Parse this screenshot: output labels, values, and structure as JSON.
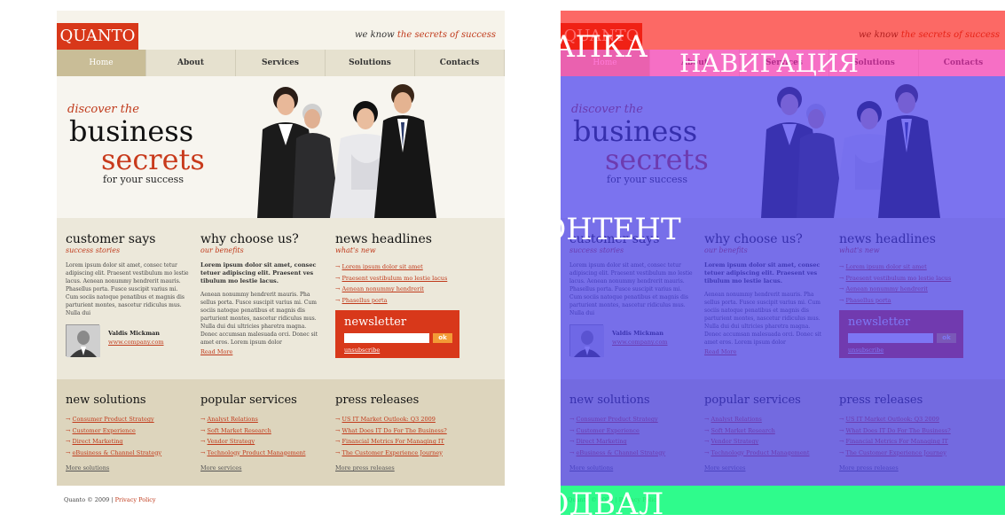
{
  "site": {
    "logo": "QUANTO",
    "tagline_pre": "we know",
    "tagline_em": "the secrets of success",
    "nav": [
      "Home",
      "About",
      "Services",
      "Solutions",
      "Contacts"
    ],
    "hero": {
      "discover": "discover the",
      "business": "business",
      "secrets": "secrets",
      "for": "for your success"
    },
    "col1": {
      "title": "customer says",
      "sub": "success stories",
      "text": "Lorem ipsum dolor sit amet, consec tetur adipiscing elit. Praesent vestibulum mo lestie lacus. Aenean nonummy hendrerit mauris. Phasellus porta. Fusce suscipit varius mi. Cum sociis natoque penatibus et magnis dis parturient montes, nascetur ridiculus mus. Nulla dui",
      "name": "Valdis Mickman",
      "link": "www.company.com"
    },
    "col2": {
      "title": "why choose us?",
      "sub": "our benefits",
      "bold": "Lorem ipsum dolor sit amet, consec tetuer adipiscing elit. Praesent ves tibulum mo lestie lacus.",
      "text": "Aenean nonummy hendrerit mauris. Pha sellus porta. Fusce suscipit varius mi. Cum sociis natoque penatibus et magnis dis parturient montes, nascetur ridiculus mus. Nulla dui dui ultricies pharetra magna. Donec accumsan malesuada orci. Donec sit amet eros. Lorem ipsum dolor",
      "more": "Read More"
    },
    "col3": {
      "title": "news headlines",
      "sub": "what's new",
      "items": [
        "Lorem ipsum dolor sit amet",
        "Praesent vestibulum mo lestie lacus",
        "Aenean nonummy hendrerit",
        "Phasellus porta"
      ]
    },
    "newsletter": {
      "title": "newsletter",
      "ok": "ok",
      "unsub": "unsubscribe"
    },
    "lower": [
      {
        "title": "new solutions",
        "items": [
          "Consumer Product Strategy",
          "Customer Experience",
          "Direct Marketing",
          "eBusiness & Channel Strategy"
        ],
        "more": "More solutions"
      },
      {
        "title": "popular services",
        "items": [
          "Analyst Relations",
          "Soft Market Research",
          "Vendor Strategy",
          "Technology Product Management"
        ],
        "more": "More services"
      },
      {
        "title": "press releases",
        "items": [
          "US IT Market Outlook: Q3 2009",
          "What Does IT Do For The Business?",
          "Financial Metrics For Managing IT",
          "The Customer Experience Journey"
        ],
        "more": "More press releases"
      }
    ],
    "footer": {
      "copy": "Quanto © 2009 |",
      "link": "Privacy Policy"
    }
  },
  "overlay": {
    "header": "ШАПКА",
    "navigation": "НАВИГАЦИЯ",
    "content": "КОНТЕНТ",
    "footer": "ПОДВАЛ",
    "colors": {
      "header": "#ff1414",
      "navigation": "#ff28be",
      "content": "#463cf0",
      "footer": "#0afa78"
    }
  },
  "colors": {
    "brand": "#d8381a",
    "accent": "#f39b36",
    "nav_active": "#c9bd97"
  }
}
